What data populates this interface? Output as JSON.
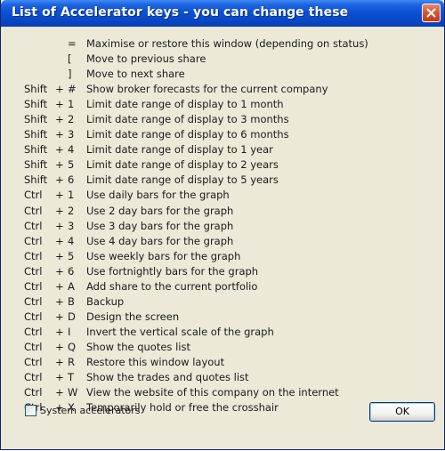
{
  "window": {
    "title": "List of Accelerator keys - you can change these"
  },
  "accelerators": [
    {
      "modifier": "",
      "separator": "",
      "key": "=",
      "description": "Maximise or restore this window (depending on status)"
    },
    {
      "modifier": "",
      "separator": "",
      "key": "[",
      "description": "Move to previous share"
    },
    {
      "modifier": "",
      "separator": "",
      "key": "]",
      "description": "Move to next share"
    },
    {
      "modifier": "Shift",
      "separator": "+",
      "key": "#",
      "description": "Show broker forecasts for the current company"
    },
    {
      "modifier": "Shift",
      "separator": "+",
      "key": "1",
      "description": "Limit date range of display to 1 month"
    },
    {
      "modifier": "Shift",
      "separator": "+",
      "key": "2",
      "description": "Limit date range of display to 3 months"
    },
    {
      "modifier": "Shift",
      "separator": "+",
      "key": "3",
      "description": "Limit date range of display to 6 months"
    },
    {
      "modifier": "Shift",
      "separator": "+",
      "key": "4",
      "description": "Limit date range of display to 1 year"
    },
    {
      "modifier": "Shift",
      "separator": "+",
      "key": "5",
      "description": "Limit date range of display to 2 years"
    },
    {
      "modifier": "Shift",
      "separator": "+",
      "key": "6",
      "description": "Limit date range of display to 5 years"
    },
    {
      "modifier": "Ctrl",
      "separator": "+",
      "key": "1",
      "description": "Use daily bars for the graph"
    },
    {
      "modifier": "Ctrl",
      "separator": "+",
      "key": "2",
      "description": "Use 2 day bars for the graph"
    },
    {
      "modifier": "Ctrl",
      "separator": "+",
      "key": "3",
      "description": "Use 3 day bars for the graph"
    },
    {
      "modifier": "Ctrl",
      "separator": "+",
      "key": "4",
      "description": "Use 4 day bars for the graph"
    },
    {
      "modifier": "Ctrl",
      "separator": "+",
      "key": "5",
      "description": "Use weekly bars for the graph"
    },
    {
      "modifier": "Ctrl",
      "separator": "+",
      "key": "6",
      "description": "Use fortnightly bars for the graph"
    },
    {
      "modifier": "Ctrl",
      "separator": "+",
      "key": "A",
      "description": "Add share to the current portfolio"
    },
    {
      "modifier": "Ctrl",
      "separator": "+",
      "key": "B",
      "description": "Backup"
    },
    {
      "modifier": "Ctrl",
      "separator": "+",
      "key": "D",
      "description": "Design the screen"
    },
    {
      "modifier": "Ctrl",
      "separator": "+",
      "key": "I",
      "description": "Invert the vertical scale of the graph"
    },
    {
      "modifier": "Ctrl",
      "separator": "+",
      "key": "Q",
      "description": "Show the quotes list"
    },
    {
      "modifier": "Ctrl",
      "separator": "+",
      "key": "R",
      "description": "Restore this window layout"
    },
    {
      "modifier": "Ctrl",
      "separator": "+",
      "key": "T",
      "description": "Show the trades and quotes list"
    },
    {
      "modifier": "Ctrl",
      "separator": "+",
      "key": "W",
      "description": "View the website of this company on the internet"
    },
    {
      "modifier": "Ctrl",
      "separator": "+",
      "key": "X",
      "description": "Temporarily hold or free the crosshair"
    }
  ],
  "footer": {
    "system_accelerators_label": "System accelerators",
    "system_accelerators_checked": false,
    "ok_label": "OK"
  },
  "colors": {
    "title_bar": "#0a52d6",
    "dialog_background": "#ece9d8",
    "close_button": "#d6542d"
  },
  "icons": {
    "close": "close-icon"
  }
}
